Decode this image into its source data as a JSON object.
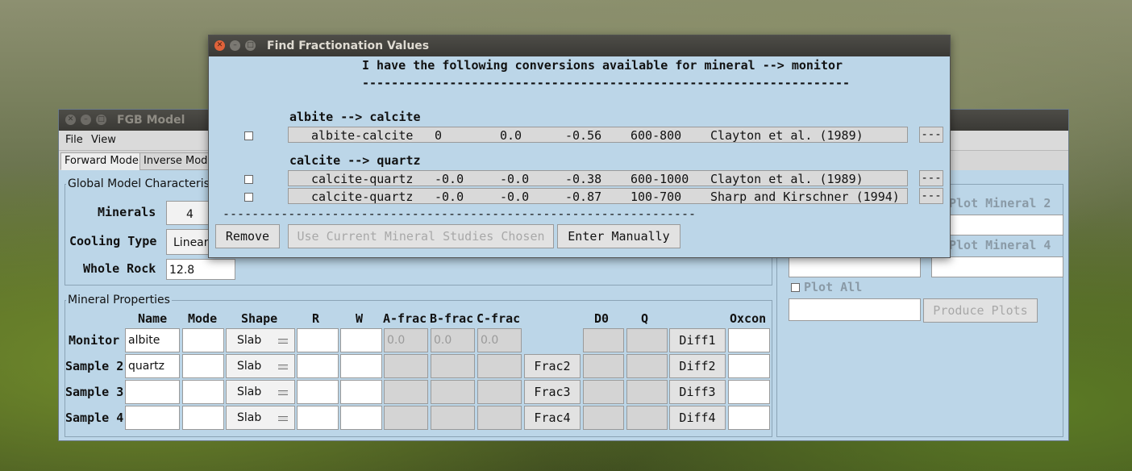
{
  "main_window": {
    "title": "FGB Model",
    "menu": [
      "File",
      "View"
    ],
    "tabs": [
      "Forward Model",
      "Inverse Model"
    ],
    "global": {
      "group_label": "Global Model Characteristics",
      "minerals_label": "Minerals",
      "minerals_value": "4",
      "cooling_label": "Cooling Type",
      "cooling_value": "Linear",
      "whole_rock_label": "Whole Rock",
      "whole_rock_value": "12.8"
    },
    "mineral_props": {
      "group_label": "Mineral Properties",
      "headers": [
        "Name",
        "Mode",
        "Shape",
        "R",
        "W",
        "A-frac",
        "B-frac",
        "C-frac",
        "D0",
        "Q",
        "Oxcon"
      ],
      "rows": [
        {
          "label": "Monitor",
          "name": "albite",
          "shape": "Slab",
          "afrac": "0.0",
          "bfrac": "0.0",
          "cfrac": "0.0",
          "frac_btn": "",
          "diff_btn": "Diff1"
        },
        {
          "label": "Sample 2",
          "name": "quartz",
          "shape": "Slab",
          "afrac": "",
          "bfrac": "",
          "cfrac": "",
          "frac_btn": "Frac2",
          "diff_btn": "Diff2"
        },
        {
          "label": "Sample 3",
          "name": "",
          "shape": "Slab",
          "afrac": "",
          "bfrac": "",
          "cfrac": "",
          "frac_btn": "Frac3",
          "diff_btn": "Diff3"
        },
        {
          "label": "Sample 4",
          "name": "",
          "shape": "Slab",
          "afrac": "",
          "bfrac": "",
          "cfrac": "",
          "frac_btn": "Frac4",
          "diff_btn": "Diff4"
        }
      ]
    },
    "plots": {
      "plot_mineral_2": "Plot Mineral 2",
      "plot_mineral_4": "Plot Mineral 4",
      "plot_all": "Plot All",
      "produce_plots": "Produce Plots"
    }
  },
  "dialog": {
    "title": "Find Fractionation Values",
    "heading": "I have the following conversions available for mineral --> monitor",
    "underline": "-------------------------------------------------------------------",
    "groups": [
      {
        "title": "albite --> calcite",
        "rows": [
          {
            "pair": "albite-calcite",
            "a": "0",
            "b": "0.0",
            "c": "-0.56",
            "range": "600-800",
            "ref": "Clayton et al. (1989)",
            "more": "---"
          }
        ]
      },
      {
        "title": "calcite --> quartz",
        "rows": [
          {
            "pair": "calcite-quartz",
            "a": "-0.0",
            "b": "-0.0",
            "c": "-0.38",
            "range": "600-1000",
            "ref": "Clayton et al. (1989)",
            "more": "---"
          },
          {
            "pair": "calcite-quartz",
            "a": "-0.0",
            "b": "-0.0",
            "c": "-0.87",
            "range": "100-700",
            "ref": "Sharp and Kirschner (1994)",
            "more": "---"
          }
        ]
      }
    ],
    "separator": "-----------------------------------------------------------------",
    "buttons": {
      "remove": "Remove",
      "use_current": "Use Current Mineral Studies Chosen",
      "enter_manually": "Enter Manually"
    }
  }
}
